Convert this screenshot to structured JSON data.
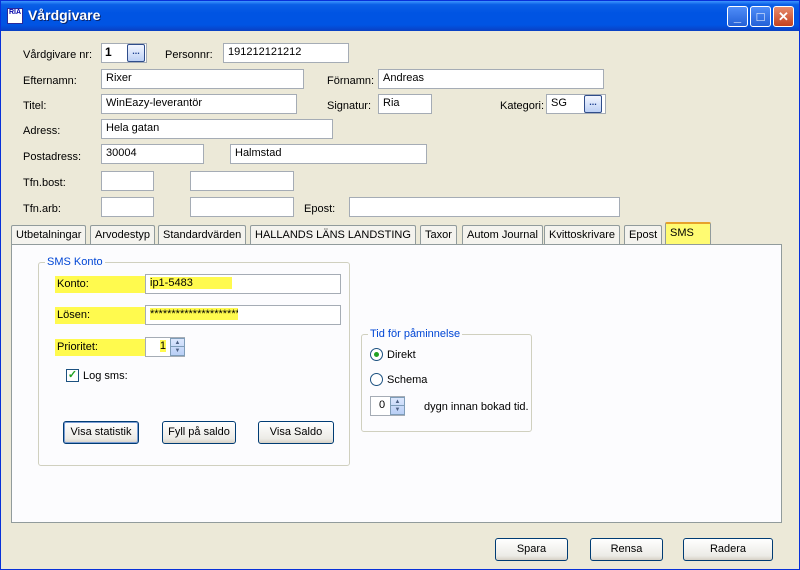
{
  "window": {
    "title": "Vårdgivare",
    "app_icon_text_top": "RIA",
    "minimize": "_",
    "maximize": "□",
    "close": "✕"
  },
  "form": {
    "vardgivare_nr_label": "Vårdgivare nr:",
    "vardgivare_nr_value": "1",
    "personnr_label": "Personnr:",
    "personnr_value": "191212121212",
    "efternamn_label": "Efternamn:",
    "efternamn_value": "Rixer",
    "fornamn_label": "Förnamn:",
    "fornamn_value": "Andreas",
    "titel_label": "Titel:",
    "titel_value": "WinEazy-leverantör",
    "signatur_label": "Signatur:",
    "signatur_value": "Ria",
    "kategori_label": "Kategori:",
    "kategori_value": "SG",
    "adress_label": "Adress:",
    "adress_value": "Hela gatan",
    "postadress_label": "Postadress:",
    "postnr_value": "30004",
    "ort_value": "Halmstad",
    "tfn_bost_label": "Tfn.bost:",
    "tfn_bost_value_1": "",
    "tfn_bost_value_2": "",
    "tfn_arb_label": "Tfn.arb:",
    "tfn_arb_value_1": "",
    "tfn_arb_value_2": "",
    "epost_label": "Epost:",
    "epost_value": "",
    "ellipsis": "..."
  },
  "tabs": [
    {
      "label": "Utbetalningar"
    },
    {
      "label": "Arvodestyp"
    },
    {
      "label": "Standardvärden"
    },
    {
      "label": "HALLANDS LÄNS LANDSTING"
    },
    {
      "label": "Taxor"
    },
    {
      "label": "Autom Journal"
    },
    {
      "label": "Kvittoskrivare"
    },
    {
      "label": "Epost"
    },
    {
      "label": "SMS"
    }
  ],
  "sms": {
    "group_title": "SMS Konto",
    "konto_label": "Konto:",
    "konto_value": "ip1-5483",
    "losen_label": "Lösen:",
    "losen_value": "**********************",
    "prioritet_label": "Prioritet:",
    "prioritet_value": "1",
    "log_sms_label": "Log sms:",
    "log_sms_checked": true,
    "visa_statistik": "Visa statistik",
    "fyll_pa_saldo": "Fyll på saldo",
    "visa_saldo": "Visa Saldo"
  },
  "reminder": {
    "group_title": "Tid för påminnelse",
    "direkt_label": "Direkt",
    "schema_label": "Schema",
    "selected": "Direkt",
    "dygn_value": "0",
    "dygn_label": "dygn innan bokad tid."
  },
  "footer": {
    "spara": "Spara",
    "rensa": "Rensa",
    "radera": "Radera"
  },
  "colors": {
    "highlight": "#fffa4e",
    "active_tab": "#fffb72",
    "titlebar": "#0054e3"
  }
}
